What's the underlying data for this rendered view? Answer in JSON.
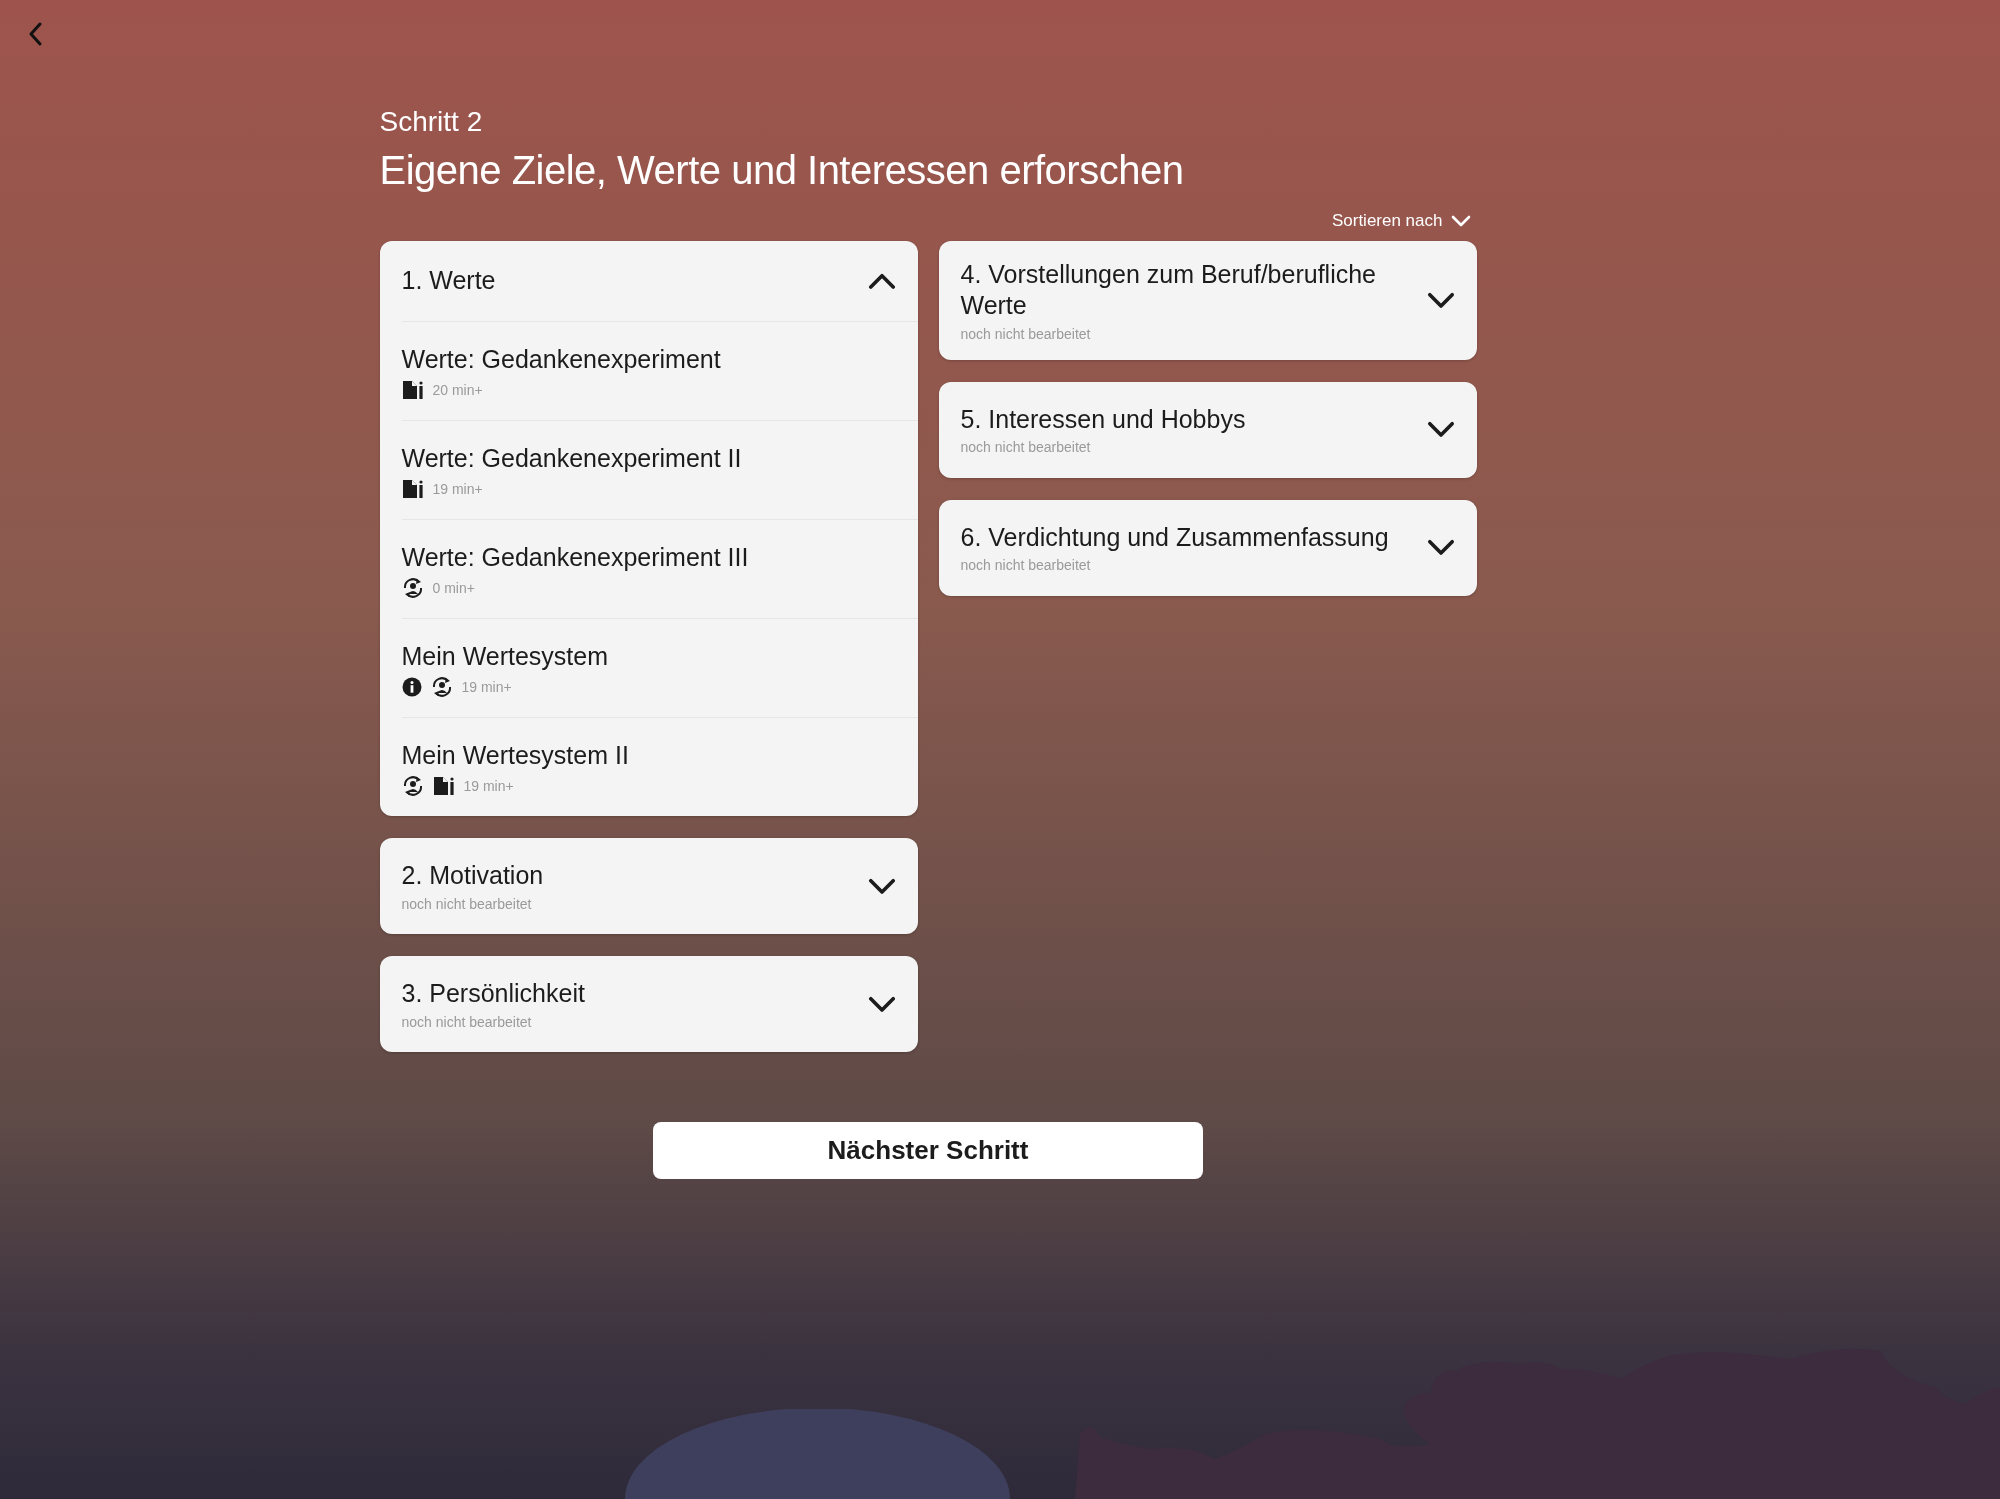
{
  "header": {
    "step": "Schritt 2",
    "title": "Eigene Ziele, Werte und Interessen erforschen"
  },
  "sort": {
    "label": "Sortieren nach"
  },
  "columns": [
    {
      "sections": [
        {
          "title": "1. Werte",
          "expanded": true,
          "items": [
            {
              "title": "Werte: Gedankenexperiment",
              "icons": [
                {
                  "kind": "document"
                }
              ],
              "duration": "20 min+"
            },
            {
              "title": "Werte: Gedankenexperiment II",
              "icons": [
                {
                  "kind": "document"
                }
              ],
              "duration": "19 min+"
            },
            {
              "title": "Werte: Gedankenexperiment III",
              "icons": [
                {
                  "kind": "exercise"
                }
              ],
              "duration": "0 min+"
            },
            {
              "title": "Mein Wertesystem",
              "icons": [
                {
                  "kind": "info"
                },
                {
                  "kind": "exercise"
                }
              ],
              "duration": "19 min+"
            },
            {
              "title": "Mein Wertesystem II",
              "icons": [
                {
                  "kind": "exercise"
                },
                {
                  "kind": "document"
                }
              ],
              "duration": "19 min+"
            }
          ]
        },
        {
          "title": "2. Motivation",
          "expanded": false,
          "status": "noch nicht bearbeitet"
        },
        {
          "title": "3. Persönlichkeit",
          "expanded": false,
          "status": "noch nicht bearbeitet"
        }
      ]
    },
    {
      "sections": [
        {
          "title": "4. Vorstellungen zum Beruf/berufliche Werte",
          "expanded": false,
          "status": "noch nicht bearbeitet"
        },
        {
          "title": "5. Interessen und Hobbys",
          "expanded": false,
          "status": "noch nicht bearbeitet"
        },
        {
          "title": "6. Verdichtung und Zusammenfassung",
          "expanded": false,
          "status": "noch nicht bearbeitet"
        }
      ]
    }
  ],
  "next_button": "Nächster Schritt"
}
